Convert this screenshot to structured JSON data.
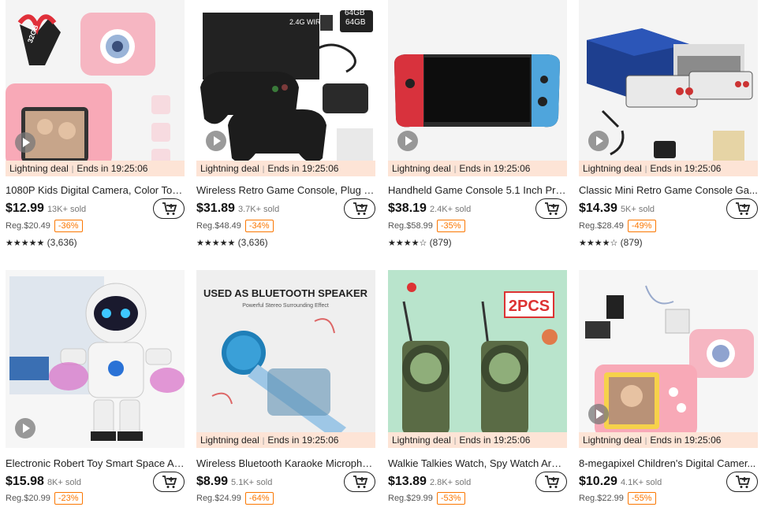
{
  "colors": {
    "accent": "#fb7701",
    "deal_bg": "#fde4d6"
  },
  "products": [
    {
      "title": "1080P Kids Digital Camera, Color Toy ...",
      "price": "$12.99",
      "sold": "13K+ sold",
      "reg": "Reg.$20.49",
      "discount": "-36%",
      "rating": "(3,636)",
      "stars": "★★★★★",
      "deal": "Lightning deal",
      "ends": "Ends in 19:25:06",
      "image_icon": "pink-camera-icon",
      "badge": "32GB"
    },
    {
      "title": "Wireless Retro Game Console, Plug &...",
      "price": "$31.89",
      "sold": "3.7K+ sold",
      "reg": "Reg.$48.49",
      "discount": "-34%",
      "rating": "(3,636)",
      "stars": "★★★★★",
      "deal": "Lightning deal",
      "ends": "Ends in 19:25:06",
      "image_icon": "game-controllers-icon",
      "badge": "64GB"
    },
    {
      "title": "Handheld Game Console 5.1 Inch Pro ...",
      "price": "$38.19",
      "sold": "2.4K+ sold",
      "reg": "Reg.$58.99",
      "discount": "-35%",
      "rating": "(879)",
      "stars": "★★★★☆",
      "deal": "Lightning deal",
      "ends": "Ends in 19:25:06",
      "image_icon": "handheld-console-icon"
    },
    {
      "title": "Classic Mini Retro Game Console Ga...",
      "price": "$14.39",
      "sold": "5K+ sold",
      "reg": "Reg.$28.49",
      "discount": "-49%",
      "rating": "(879)",
      "stars": "★★★★☆",
      "deal": "Lightning deal",
      "ends": "Ends in 19:25:06",
      "image_icon": "retro-console-icon"
    },
    {
      "title": "Electronic Robert Toy Smart Space As...",
      "price": "$15.98",
      "sold": "8K+ sold",
      "reg": "Reg.$20.99",
      "discount": "-23%",
      "image_icon": "robot-toy-icon"
    },
    {
      "title": "Wireless Bluetooth Karaoke Micropho...",
      "price": "$8.99",
      "sold": "5.1K+ sold",
      "reg": "Reg.$24.99",
      "discount": "-64%",
      "deal": "Lightning deal",
      "ends": "Ends in 19:25:06",
      "image_icon": "karaoke-microphone-icon",
      "banner": "USED AS BLUETOOTH SPEAKER",
      "banner_sub": "Powerful Stereo Surrounding Effect"
    },
    {
      "title": "Walkie Talkies Watch, Spy Watch Arm...",
      "price": "$13.89",
      "sold": "2.8K+ sold",
      "reg": "Reg.$29.99",
      "discount": "-53%",
      "deal": "Lightning deal",
      "ends": "Ends in 19:25:06",
      "image_icon": "walkie-talkie-watch-icon",
      "badge": "2PCS"
    },
    {
      "title": "8-megapixel Children's Digital Camer...",
      "price": "$10.29",
      "sold": "4.1K+ sold",
      "reg": "Reg.$22.99",
      "discount": "-55%",
      "deal": "Lightning deal",
      "ends": "Ends in 19:25:06",
      "image_icon": "kids-camera-icon"
    }
  ]
}
